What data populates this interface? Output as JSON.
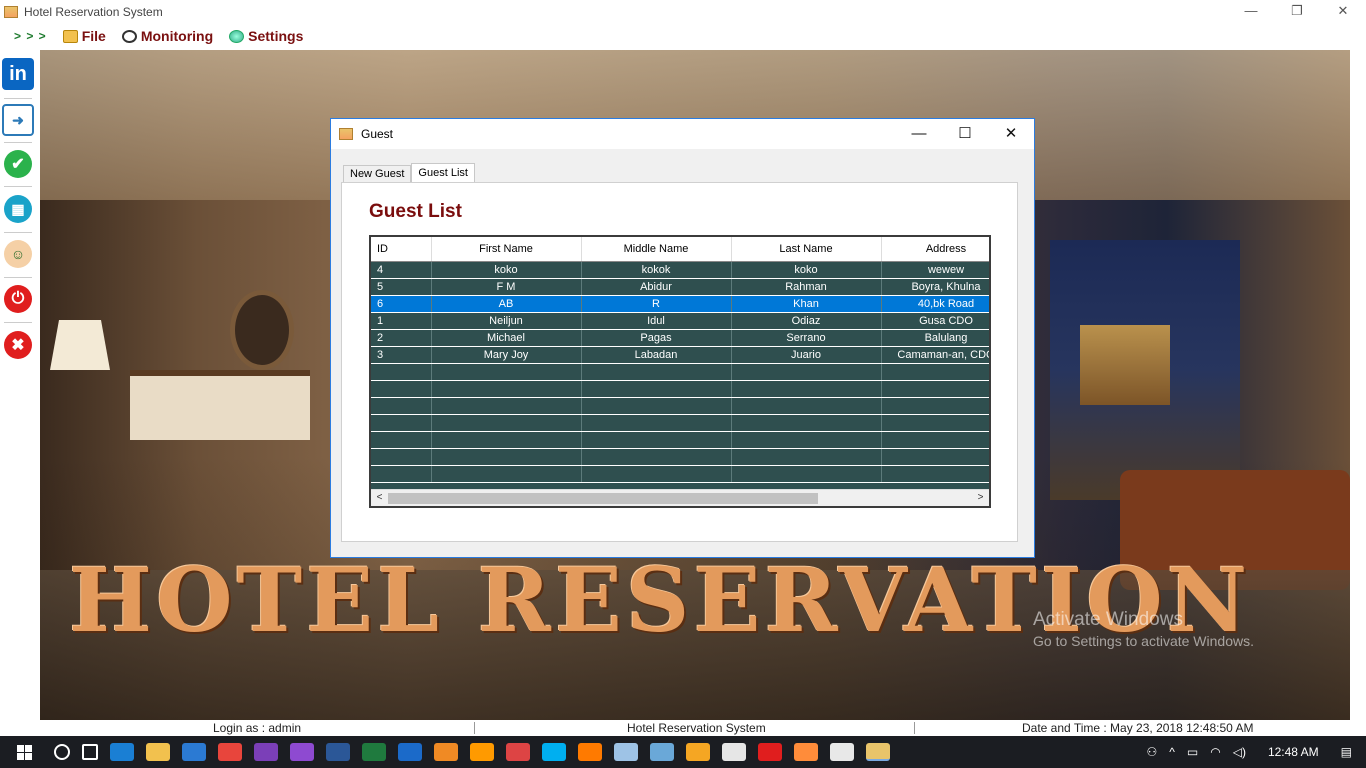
{
  "window": {
    "title": "Hotel Reservation System",
    "controls": [
      "—",
      "❐",
      "✕"
    ]
  },
  "menu": {
    "arrows": "> > >",
    "items": [
      {
        "label": "File",
        "icon": "folder-icon"
      },
      {
        "label": "Monitoring",
        "icon": "monitor-icon"
      },
      {
        "label": "Settings",
        "icon": "settings-icon"
      }
    ]
  },
  "sidebar": {
    "buttons": [
      {
        "name": "check-in",
        "glyph": "in"
      },
      {
        "name": "check-out",
        "glyph": "➜"
      },
      {
        "name": "confirm",
        "glyph": "✔"
      },
      {
        "name": "hotel",
        "glyph": "▦"
      },
      {
        "name": "guest",
        "glyph": "☺"
      },
      {
        "name": "logout",
        "glyph": "⏻"
      },
      {
        "name": "exit",
        "glyph": "✖"
      }
    ]
  },
  "background": {
    "banner": "HOTEL RESERVATION",
    "activate_line1": "Activate Windows",
    "activate_line2": "Go to Settings to activate Windows."
  },
  "guest_window": {
    "title": "Guest",
    "controls": [
      "—",
      "☐",
      "✕"
    ],
    "tabs": [
      "New Guest",
      "Guest List"
    ],
    "active_tab": "Guest List",
    "heading": "Guest List",
    "columns": [
      "ID",
      "First Name",
      "Middle Name",
      "Last Name",
      "Address"
    ],
    "rows": [
      [
        "4",
        "koko",
        "kokok",
        "koko",
        "wewew"
      ],
      [
        "5",
        "F M",
        "Abidur",
        "Rahman",
        "Boyra, Khulna"
      ],
      [
        "6",
        "AB",
        "R",
        "Khan",
        "40,bk Road"
      ],
      [
        "1",
        "Neiljun",
        "Idul",
        "Odiaz",
        "Gusa CDO"
      ],
      [
        "2",
        "Michael",
        "Pagas",
        "Serrano",
        "Balulang"
      ],
      [
        "3",
        "Mary Joy",
        "Labadan",
        "Juario",
        "Camaman-an, CDO"
      ]
    ],
    "selected_row_id": "6",
    "scroll_left": "<",
    "scroll_right": ">"
  },
  "status": {
    "login": "Login as : admin",
    "system": "Hotel Reservation System",
    "datetime": "Date and Time : May 23, 2018 12:48:50 AM"
  },
  "taskbar": {
    "clock": "12:48 AM",
    "pinned": [
      "search",
      "task-view",
      "edge",
      "explorer",
      "store",
      "chrome",
      "visual-studio",
      "visual-studio-2",
      "word",
      "excel",
      "teamviewer",
      "xampp",
      "illustrator",
      "paint",
      "skype",
      "firefox",
      "notepad",
      "app",
      "sublime",
      "mail",
      "opera",
      "photos",
      "obs",
      "hotel-app"
    ]
  },
  "colors": {
    "grid_bg": "#2f4f4f",
    "selected_row": "#0078d7",
    "heading": "#7a0d0d",
    "menu_text": "#7a1010",
    "banner": "#e39a5c"
  }
}
